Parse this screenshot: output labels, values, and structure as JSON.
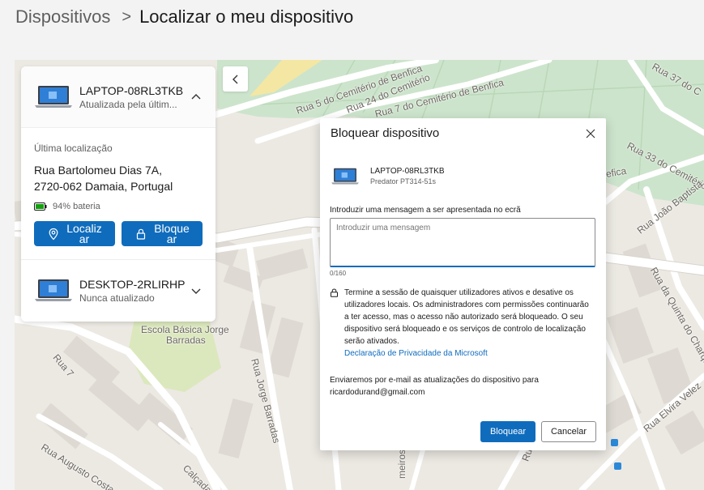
{
  "breadcrumb": {
    "parent": "Dispositivos",
    "separator": ">",
    "current": "Localizar o meu dispositivo"
  },
  "devices": [
    {
      "name": "LAPTOP-08RL3TKB",
      "status": "Atualizada pela últim...",
      "location_label": "Última localização",
      "address_line1": "Rua Bartolomeu Dias 7A,",
      "address_line2": "2720-062 Damaia, Portugal",
      "battery": "94% bateria",
      "locate_label": "Localizar",
      "lock_label": "Bloquear",
      "expanded": true
    },
    {
      "name": "DESKTOP-2RLIRHP",
      "status": "Nunca atualizado",
      "expanded": false
    }
  ],
  "map": {
    "labels": [
      "Rua 5 do Cemitério de Benfica",
      "Rua 24 do Cemitério",
      "Rua 7 do Cemitério de Benfica",
      "Rua 37 do C",
      "Rua 33 do Cemitério",
      "efica",
      "Rua João Baptista",
      "Rua da Quinta do Charque",
      "Escola Básica Jorge",
      "Barradas",
      "Rua Jorge Barradas",
      "Rua 7",
      "Rua Augusto Costa-Co",
      "Calçada d",
      "Rua Elvira Velez",
      "Rua João de",
      "meiros"
    ]
  },
  "dialog": {
    "title": "Bloquear dispositivo",
    "device_name": "LAPTOP-08RL3TKB",
    "device_model": "Predator PT314-51s",
    "message_label": "Introduzir uma mensagem a ser apresentada no ecrã",
    "message_placeholder": "Introduzir uma mensagem",
    "message_value": "",
    "counter": "0/160",
    "lock_description": "Termine a sessão de quaisquer utilizadores ativos e desative os utilizadores locais. Os administradores com permissões continuarão a ter acesso, mas o acesso não autorizado será bloqueado. O seu dispositivo será bloqueado e os serviços de controlo de localização serão ativados.",
    "privacy_link": "Declaração de Privacidade da Microsoft",
    "email_note": "Enviaremos por e-mail as atualizações do dispositivo para ricardodurand@gmail.com",
    "confirm_label": "Bloquear",
    "cancel_label": "Cancelar"
  },
  "colors": {
    "accent": "#0f6cbd",
    "battery": "#13a10e",
    "map_park": "#cde4cc",
    "map_school": "#dbe8bd",
    "map_background": "#ece9e3"
  },
  "icons": {
    "collapse": "chevron-left-icon",
    "device": "laptop-icon",
    "expand": "chevron-down-icon",
    "collapse_device": "chevron-up-icon",
    "locate": "location-pin-icon",
    "lock": "lock-icon",
    "battery": "battery-icon",
    "close": "close-icon"
  }
}
